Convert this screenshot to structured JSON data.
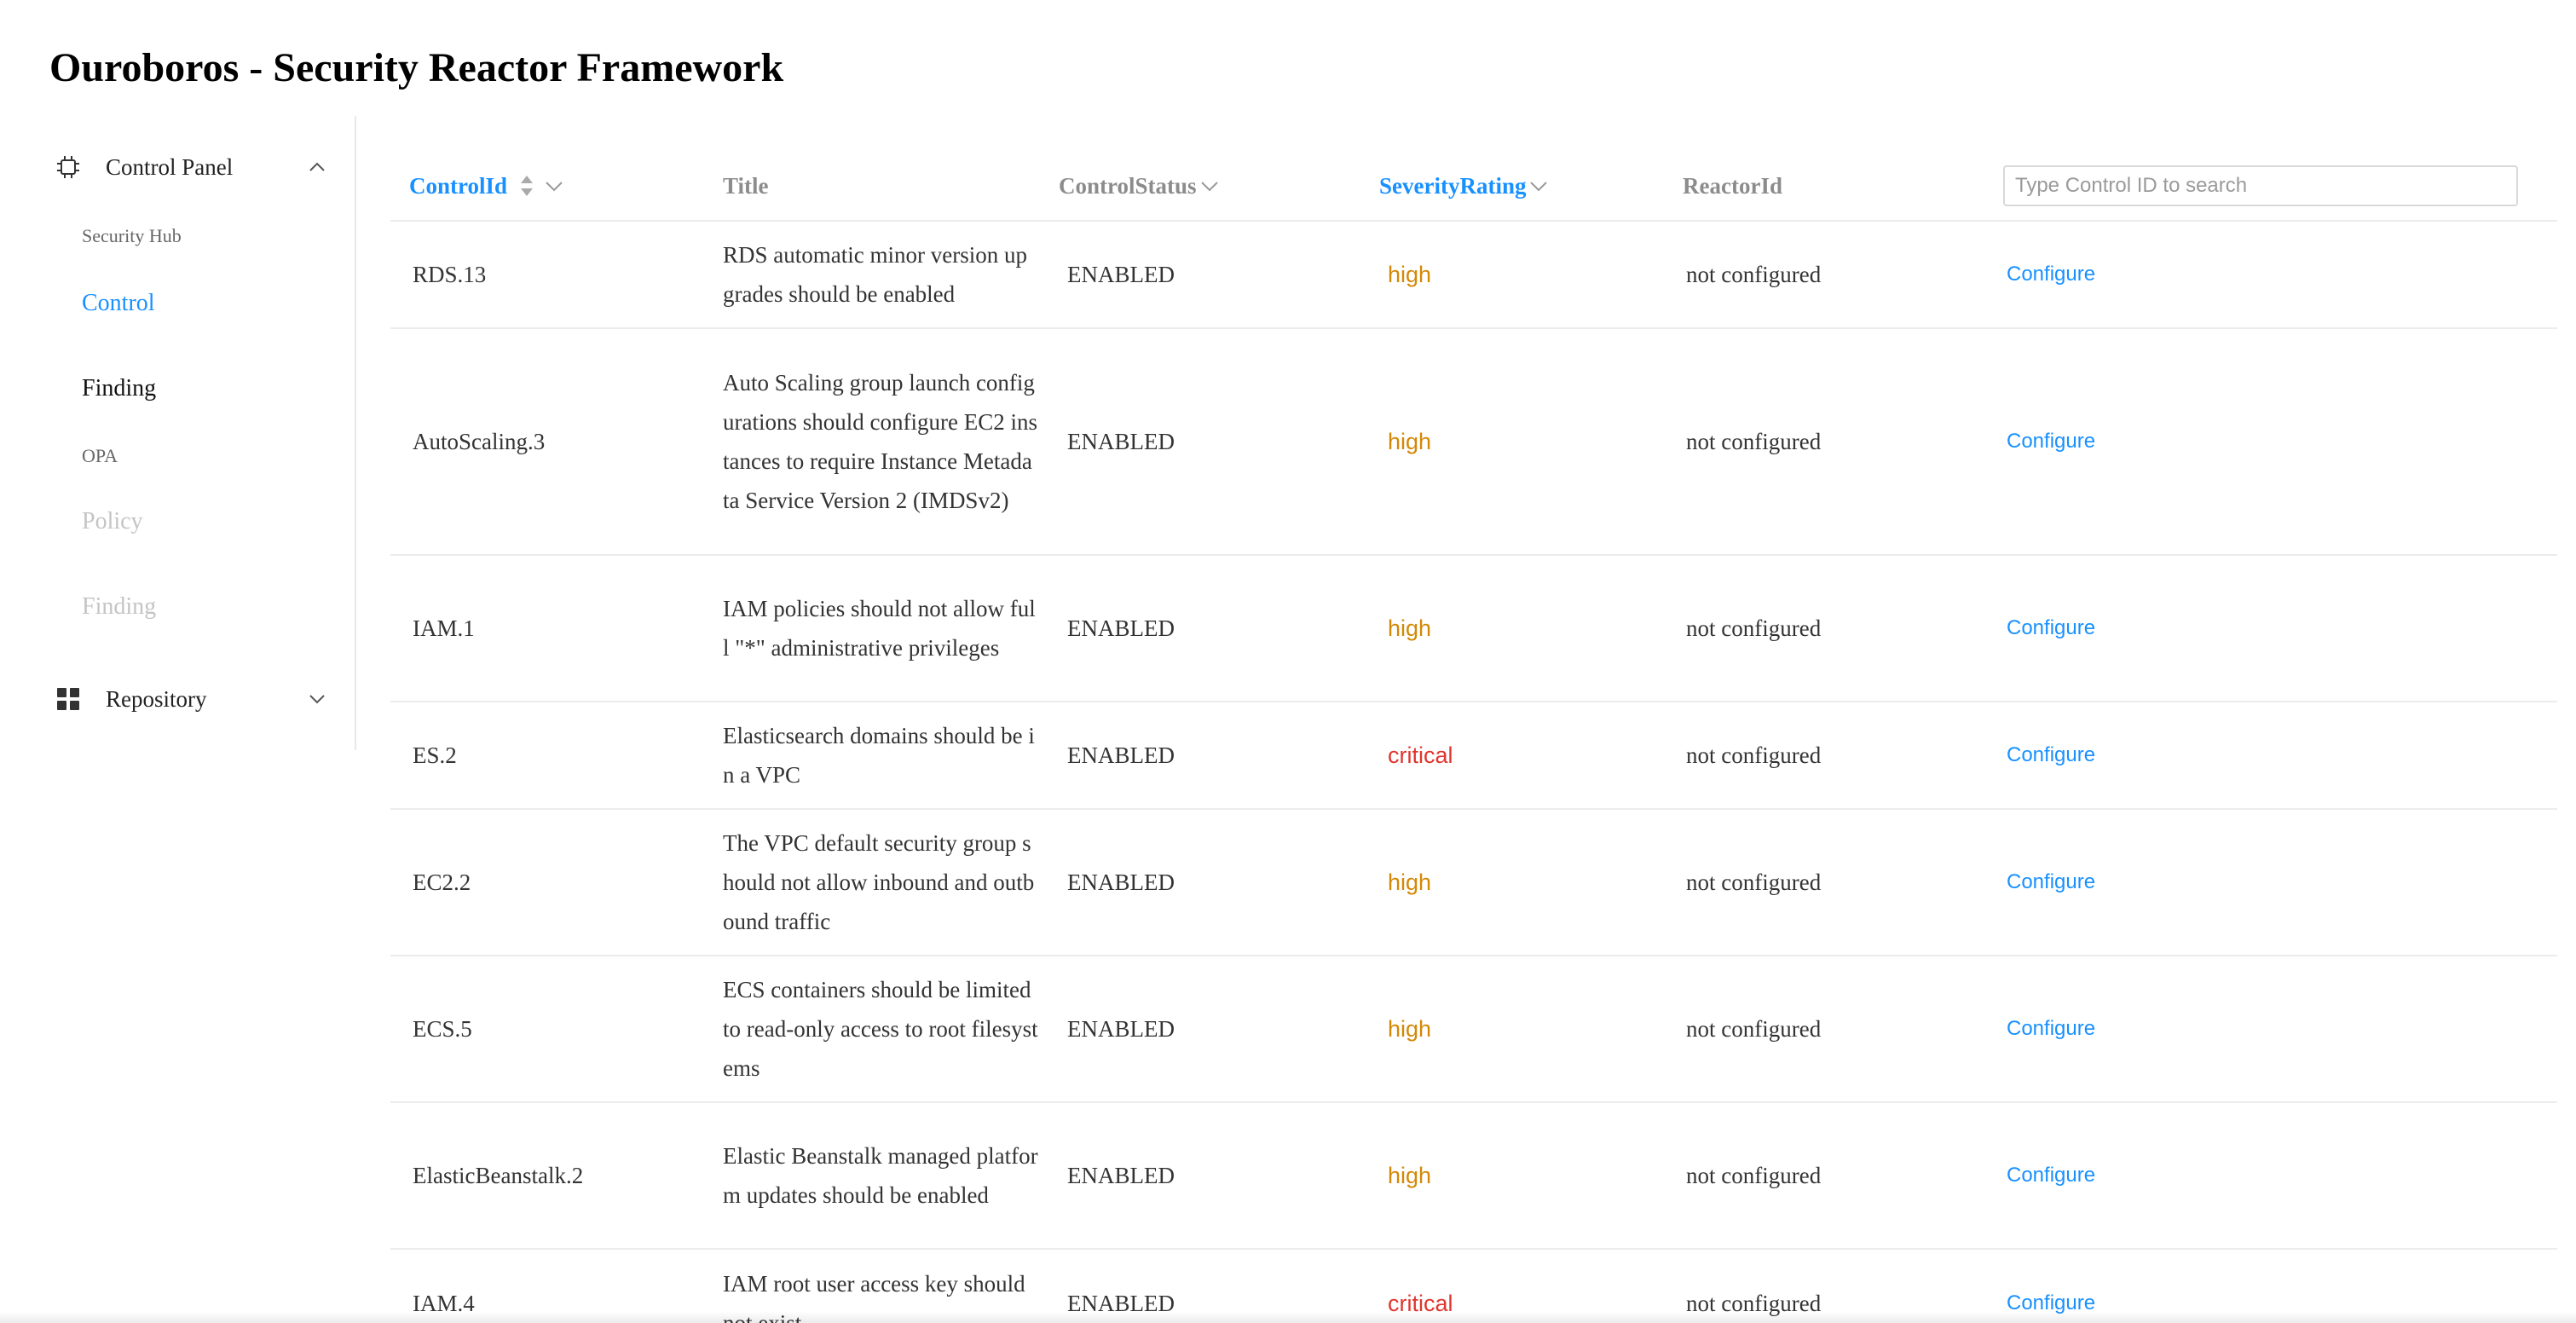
{
  "app": {
    "title": "Ouroboros - Security Reactor Framework"
  },
  "sidebar": {
    "control_panel": {
      "label": "Control Panel",
      "icon": "chip-icon",
      "expanded": true,
      "items": [
        {
          "label": "Security Hub",
          "state": "group-label"
        },
        {
          "label": "Control",
          "state": "active"
        },
        {
          "label": "Finding",
          "state": "normal"
        },
        {
          "label": "OPA",
          "state": "group-label"
        },
        {
          "label": "Policy",
          "state": "disabled"
        },
        {
          "label": "Finding",
          "state": "disabled"
        }
      ]
    },
    "repository": {
      "label": "Repository",
      "icon": "grid-icon",
      "expanded": false
    }
  },
  "table": {
    "columns": {
      "control_id": "ControlId",
      "title": "Title",
      "control_status": "ControlStatus",
      "severity_rating": "SeverityRating",
      "reactor_id": "ReactorId"
    },
    "search": {
      "placeholder": "Type Control ID to search",
      "value": ""
    },
    "rows": [
      {
        "control_id": "RDS.13",
        "title": "RDS automatic minor version upgrades should be enabled",
        "status": "ENABLED",
        "severity": "high",
        "reactor": "not configured",
        "action": "Configure"
      },
      {
        "control_id": "AutoScaling.3",
        "title": "Auto Scaling group launch configurations should configure EC2 instances to require Instance Metadata Service Version 2 (IMDSv2)",
        "status": "ENABLED",
        "severity": "high",
        "reactor": "not configured",
        "action": "Configure"
      },
      {
        "control_id": "IAM.1",
        "title": "IAM policies should not allow full \"*\" administrative privileges",
        "status": "ENABLED",
        "severity": "high",
        "reactor": "not configured",
        "action": "Configure"
      },
      {
        "control_id": "ES.2",
        "title": "Elasticsearch domains should be in a VPC",
        "status": "ENABLED",
        "severity": "critical",
        "reactor": "not configured",
        "action": "Configure"
      },
      {
        "control_id": "EC2.2",
        "title": "The VPC default security group should not allow inbound and outbound traffic",
        "status": "ENABLED",
        "severity": "high",
        "reactor": "not configured",
        "action": "Configure"
      },
      {
        "control_id": "ECS.5",
        "title": "ECS containers should be limited to read-only access to root filesystems",
        "status": "ENABLED",
        "severity": "high",
        "reactor": "not configured",
        "action": "Configure"
      },
      {
        "control_id": "ElasticBeanstalk.2",
        "title": "Elastic Beanstalk managed platform updates should be enabled",
        "status": "ENABLED",
        "severity": "high",
        "reactor": "not configured",
        "action": "Configure"
      },
      {
        "control_id": "IAM.4",
        "title": "IAM root user access key should not exist",
        "status": "ENABLED",
        "severity": "critical",
        "reactor": "not configured",
        "action": "Configure"
      }
    ]
  },
  "colors": {
    "accent": "#1890ff",
    "severity_high": "#d48806",
    "severity_critical": "#e0362f",
    "header_text": "#8c8c8c",
    "disabled_text": "#c4c4c4"
  }
}
